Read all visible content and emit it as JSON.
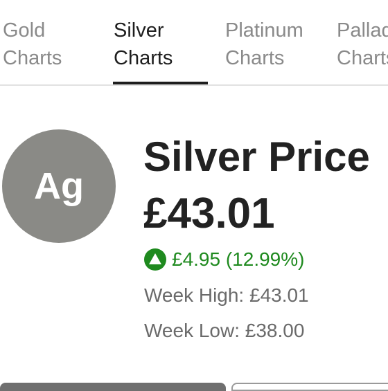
{
  "tabs": [
    {
      "label": "Gold\nCharts"
    },
    {
      "label": "Silver\nCharts"
    },
    {
      "label": "Platinum\nCharts"
    },
    {
      "label": "Palladium\nCharts"
    }
  ],
  "metal": {
    "symbol": "Ag",
    "title": "Silver Price",
    "price": "£43.01",
    "change": "£4.95 (12.99%)",
    "week_high": "Week High: £43.01",
    "week_low": "Week Low: £38.00"
  },
  "colors": {
    "badge": "#8a8a86",
    "positive": "#1f8a1f"
  },
  "icons": {
    "change": "triangle-up-icon"
  }
}
